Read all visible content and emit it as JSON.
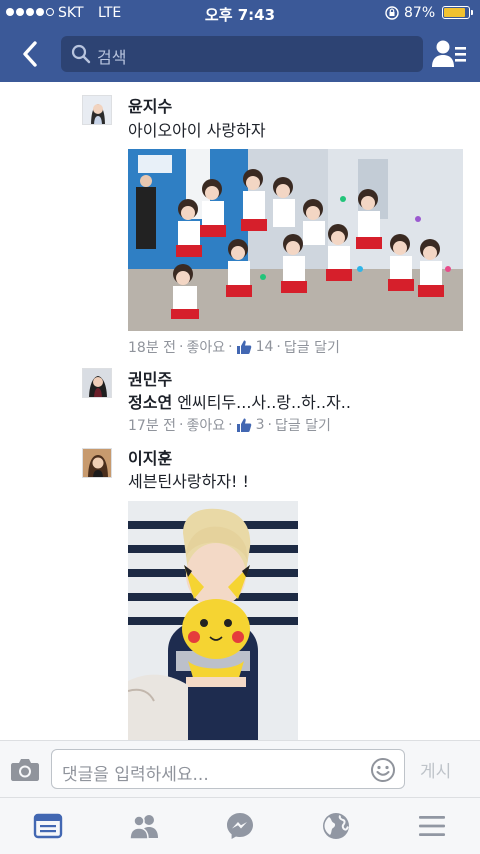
{
  "status_bar": {
    "carrier": "SKT",
    "network": "LTE",
    "time": "오후 7:43",
    "battery_percent_text": "87%",
    "battery_level": 0.87,
    "signal_bars_filled": 4,
    "signal_bars_total": 5
  },
  "nav": {
    "search_placeholder": "검색",
    "back_icon": "chevron-left-icon",
    "friends_icon": "friend-requests-icon",
    "bar_color": "#3b5998"
  },
  "comments": [
    {
      "author": "윤지수",
      "text": "아이오아이 사랑하자",
      "time": "18분 전",
      "like_label": "좋아요",
      "like_count": "14",
      "reply_label": "답글 달기",
      "photo": "group-photo-image"
    },
    {
      "author": "권민주",
      "tagged_name": "정소연",
      "text": "엔씨티두...사..랑..하..자..",
      "time": "17분 전",
      "like_label": "좋아요",
      "like_count": "3",
      "reply_label": "답글 달기"
    },
    {
      "author": "이지훈",
      "text": "세븐틴사랑하자! !",
      "photo": "pikachu-balloon-photo-image"
    }
  ],
  "composer": {
    "placeholder": "댓글을 입력하세요...",
    "post_label": "게시",
    "camera_icon": "camera-icon",
    "emoji_icon": "emoji-icon"
  },
  "tabs": [
    {
      "name": "news-feed-icon",
      "active": true
    },
    {
      "name": "friends-icon",
      "active": false
    },
    {
      "name": "messenger-icon",
      "active": false
    },
    {
      "name": "notifications-globe-icon",
      "active": false
    },
    {
      "name": "menu-icon",
      "active": false
    }
  ],
  "colors": {
    "brand": "#3b5998",
    "like_blue": "#4267b2",
    "meta_gray": "#90949c",
    "tab_active": "#4267b2",
    "tab_inactive": "#9197a3"
  }
}
